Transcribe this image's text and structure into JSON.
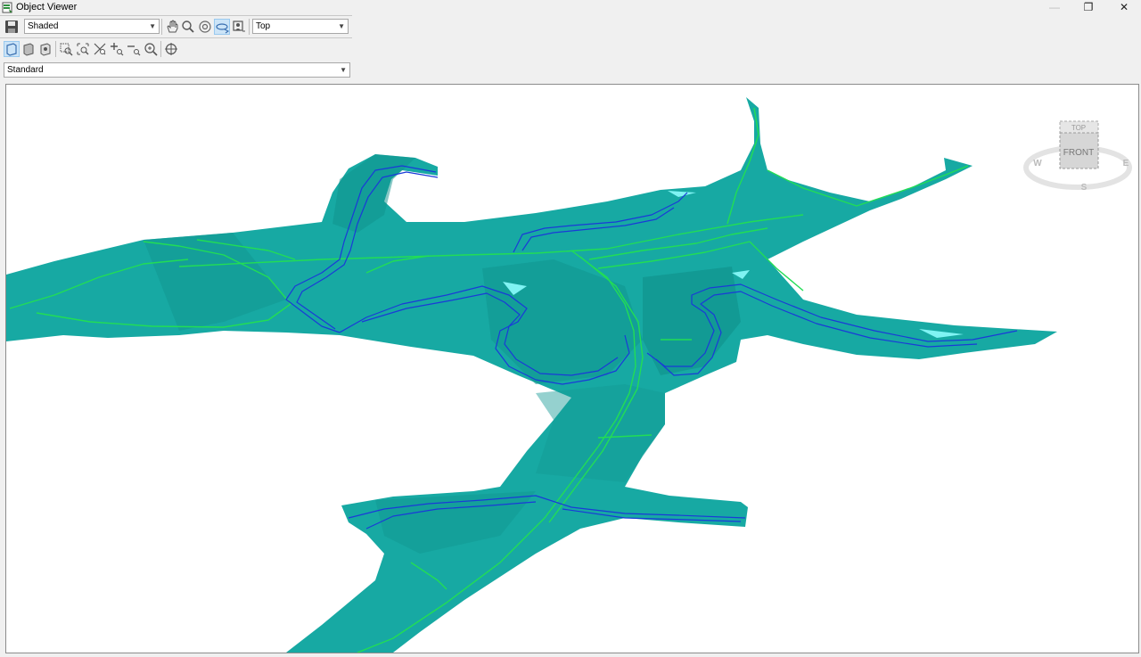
{
  "window": {
    "title": "Object Viewer",
    "minimize": "—",
    "maximize": "❐",
    "close": "✕"
  },
  "toolbar": {
    "visual_style": "Shaded",
    "view_direction": "Top",
    "view_style": "Standard"
  },
  "viewcube": {
    "face_label": "FRONT",
    "top_label": "TOP",
    "compass": {
      "west": "W",
      "east": "E",
      "south": "S"
    }
  },
  "colors": {
    "surface": "#17a9a3",
    "surface_dark": "#0f8f8a",
    "road_lines": "#22dd55",
    "channel_lines": "#1a3ad8",
    "highlight": "#7ff3f3"
  }
}
